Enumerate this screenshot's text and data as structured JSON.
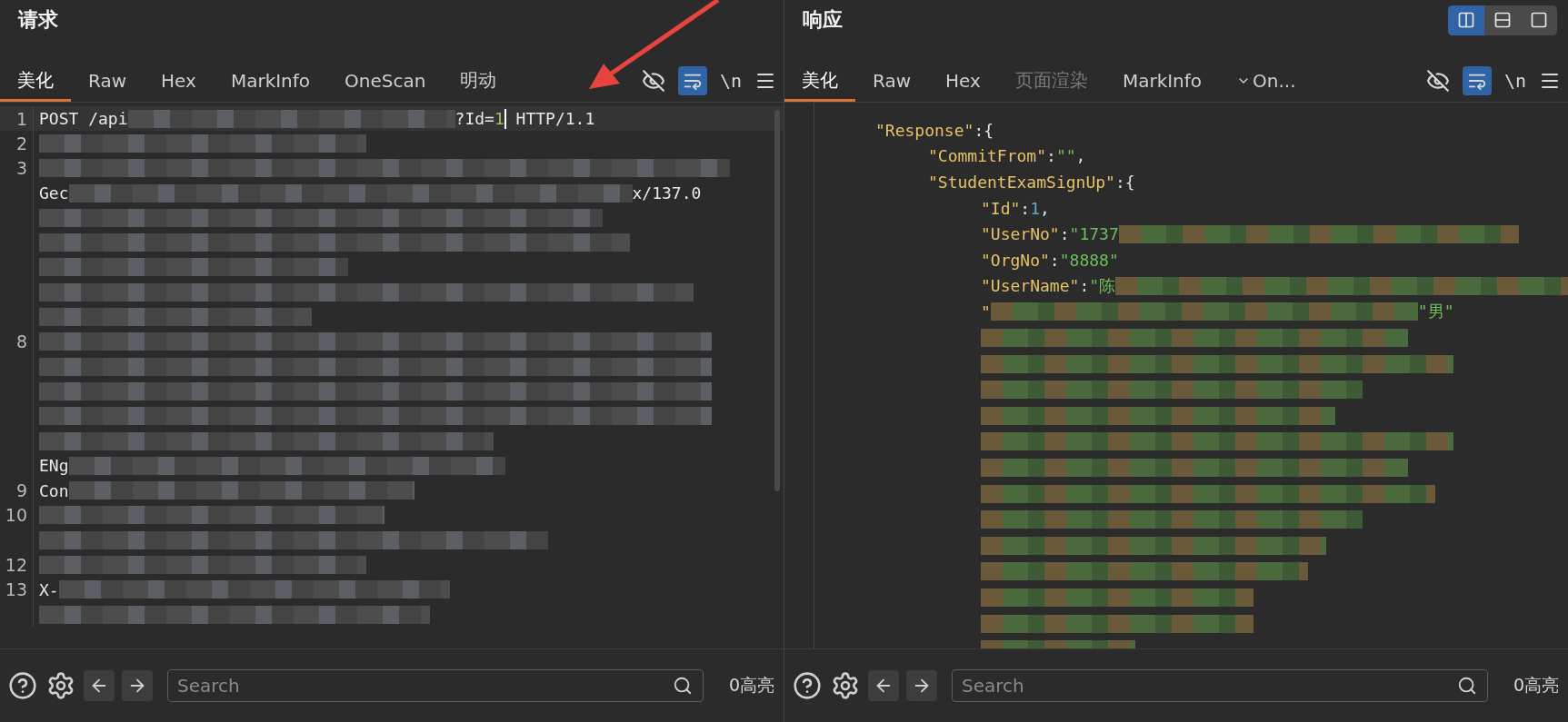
{
  "layout_modes": [
    {
      "selected": true
    },
    {
      "selected": false
    },
    {
      "selected": false
    }
  ],
  "panels": [
    {
      "kind": "request",
      "title": "请求",
      "tabs": [
        {
          "label": "美化",
          "selected": true,
          "disabled": false
        },
        {
          "label": "Raw",
          "selected": false,
          "disabled": false
        },
        {
          "label": "Hex",
          "selected": false,
          "disabled": false
        },
        {
          "label": "MarkInfo",
          "selected": false,
          "disabled": false
        },
        {
          "label": "OneScan",
          "selected": false,
          "disabled": false
        },
        {
          "label": "明动",
          "selected": false,
          "disabled": false
        }
      ],
      "wrap_selected": true,
      "newline_label": "\\n",
      "lines": [
        {
          "number": "1",
          "segments": [
            {
              "kind": "text",
              "text": "POST /api"
            },
            {
              "kind": "redacted"
            },
            {
              "kind": "text",
              "text": "?Id="
            },
            {
              "kind": "number",
              "text": "1"
            },
            {
              "kind": "cursor"
            },
            {
              "kind": "text",
              "text": " HTTP/1.1"
            }
          ]
        },
        {
          "number": "2",
          "segments": [
            {
              "kind": "redacted"
            }
          ]
        },
        {
          "number": "3",
          "segments": [
            {
              "kind": "redacted"
            }
          ]
        },
        {
          "segments": [
            {
              "kind": "text",
              "text": "Gec"
            },
            {
              "kind": "redacted"
            },
            {
              "kind": "text",
              "text": "x/137.0"
            }
          ]
        },
        {
          "segments": [
            {
              "kind": "redacted"
            }
          ]
        },
        {
          "segments": [
            {
              "kind": "redacted"
            }
          ]
        },
        {
          "segments": [
            {
              "kind": "redacted"
            }
          ]
        },
        {
          "segments": [
            {
              "kind": "redacted"
            }
          ]
        },
        {
          "segments": [
            {
              "kind": "redacted"
            }
          ]
        },
        {
          "number": "8",
          "segments": [
            {
              "kind": "redacted"
            }
          ]
        },
        {
          "segments": [
            {
              "kind": "redacted"
            }
          ]
        },
        {
          "segments": [
            {
              "kind": "redacted"
            }
          ]
        },
        {
          "segments": [
            {
              "kind": "redacted"
            }
          ]
        },
        {
          "segments": [
            {
              "kind": "redacted"
            }
          ]
        },
        {
          "segments": [
            {
              "kind": "text",
              "text": "ENg"
            },
            {
              "kind": "redacted"
            }
          ]
        },
        {
          "number": "9",
          "segments": [
            {
              "kind": "text",
              "text": "Con"
            },
            {
              "kind": "redacted"
            }
          ]
        },
        {
          "number": "10",
          "segments": [
            {
              "kind": "redacted"
            }
          ]
        },
        {
          "segments": [
            {
              "kind": "redacted"
            }
          ]
        },
        {
          "number": "12",
          "segments": [
            {
              "kind": "redacted"
            }
          ]
        },
        {
          "number": "13",
          "segments": [
            {
              "kind": "text",
              "text": "X-"
            },
            {
              "kind": "redacted"
            }
          ]
        },
        {
          "segments": [
            {
              "kind": "redacted"
            }
          ]
        }
      ],
      "search": {
        "placeholder": "Search"
      },
      "highlight_count": "0高亮"
    },
    {
      "kind": "response",
      "title": "响应",
      "tabs": [
        {
          "label": "美化",
          "selected": true,
          "disabled": false
        },
        {
          "label": "Raw",
          "selected": false,
          "disabled": false
        },
        {
          "label": "Hex",
          "selected": false,
          "disabled": false
        },
        {
          "label": "页面渲染",
          "selected": false,
          "disabled": true
        },
        {
          "label": "MarkInfo",
          "selected": false,
          "disabled": false
        },
        {
          "label": "On...",
          "selected": false,
          "disabled": false,
          "dropdown": true
        }
      ],
      "wrap_selected": true,
      "newline_label": "\\n",
      "tree": [
        {
          "segments": [
            {
              "kind": "key",
              "text": "\"Response\""
            },
            {
              "kind": "punct",
              "text": ":{"
            }
          ],
          "children": [
            {
              "segments": [
                {
                  "kind": "key",
                  "text": "\"CommitFrom\""
                },
                {
                  "kind": "punct",
                  "text": ":"
                },
                {
                  "kind": "string",
                  "text": "\"\""
                },
                {
                  "kind": "punct",
                  "text": ","
                }
              ]
            },
            {
              "segments": [
                {
                  "kind": "key",
                  "text": "\"StudentExamSignUp\""
                },
                {
                  "kind": "punct",
                  "text": ":{"
                }
              ],
              "children": [
                {
                  "segments": [
                    {
                      "kind": "key",
                      "text": "\"Id\""
                    },
                    {
                      "kind": "punct",
                      "text": ":"
                    },
                    {
                      "kind": "number",
                      "text": "1"
                    },
                    {
                      "kind": "punct",
                      "text": ","
                    }
                  ]
                },
                {
                  "segments": [
                    {
                      "kind": "key",
                      "text": "\"UserNo\""
                    },
                    {
                      "kind": "punct",
                      "text": ":"
                    },
                    {
                      "kind": "string",
                      "text": "\"1737"
                    },
                    {
                      "kind": "redacted"
                    }
                  ]
                },
                {
                  "segments": [
                    {
                      "kind": "key",
                      "text": "\"OrgNo\""
                    },
                    {
                      "kind": "punct",
                      "text": ":"
                    },
                    {
                      "kind": "string",
                      "text": "\"8888\""
                    }
                  ]
                },
                {
                  "segments": [
                    {
                      "kind": "key",
                      "text": "\"UserName\""
                    },
                    {
                      "kind": "punct",
                      "text": ":"
                    },
                    {
                      "kind": "string",
                      "text": "\"陈"
                    },
                    {
                      "kind": "redacted"
                    }
                  ]
                },
                {
                  "segments": [
                    {
                      "kind": "key",
                      "text": "\""
                    },
                    {
                      "kind": "redacted"
                    },
                    {
                      "kind": "string",
                      "text": "\"男\""
                    }
                  ]
                },
                {
                  "segments": [
                    {
                      "kind": "redacted"
                    }
                  ]
                },
                {
                  "segments": [
                    {
                      "kind": "redacted"
                    }
                  ]
                },
                {
                  "segments": [
                    {
                      "kind": "redacted"
                    }
                  ]
                },
                {
                  "segments": [
                    {
                      "kind": "redacted"
                    }
                  ]
                },
                {
                  "segments": [
                    {
                      "kind": "redacted"
                    }
                  ]
                },
                {
                  "segments": [
                    {
                      "kind": "redacted"
                    }
                  ]
                },
                {
                  "segments": [
                    {
                      "kind": "redacted"
                    }
                  ]
                },
                {
                  "segments": [
                    {
                      "kind": "redacted"
                    }
                  ]
                },
                {
                  "segments": [
                    {
                      "kind": "redacted"
                    }
                  ]
                },
                {
                  "segments": [
                    {
                      "kind": "redacted"
                    }
                  ]
                },
                {
                  "segments": [
                    {
                      "kind": "redacted"
                    }
                  ]
                },
                {
                  "segments": [
                    {
                      "kind": "redacted"
                    }
                  ]
                },
                {
                  "segments": [
                    {
                      "kind": "redacted"
                    }
                  ]
                }
              ]
            }
          ]
        }
      ],
      "search": {
        "placeholder": "Search"
      },
      "highlight_count": "0高亮"
    }
  ]
}
